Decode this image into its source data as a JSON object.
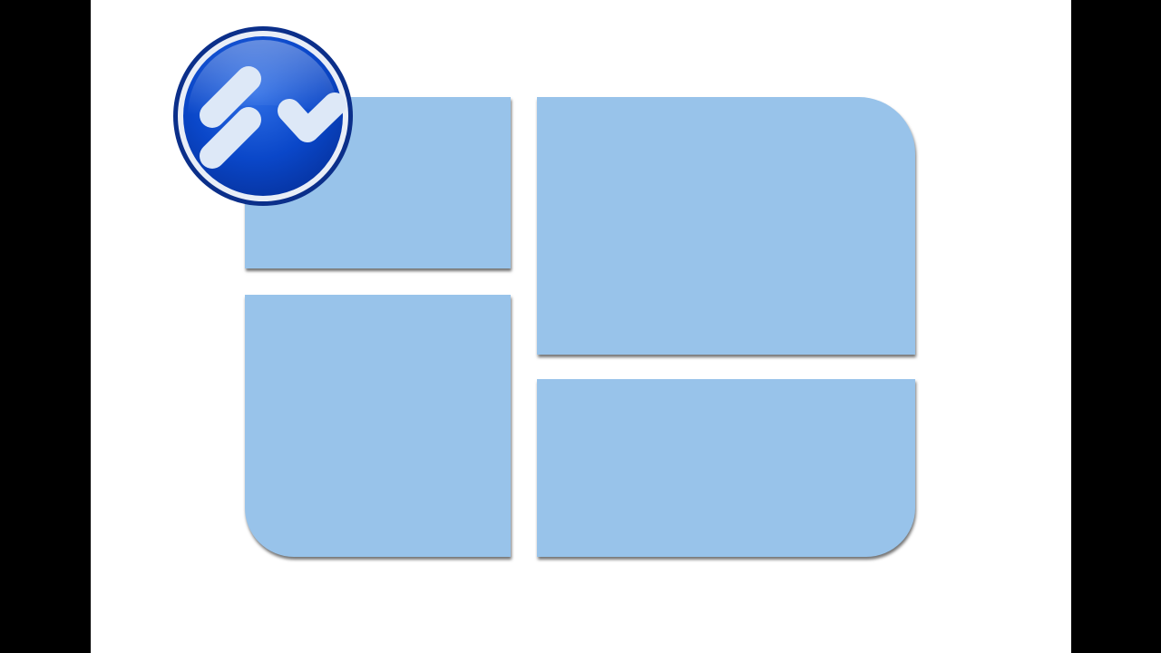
{
  "colors": {
    "background": "#ffffff",
    "letterbox": "#000000",
    "pane_fill": "#98c3ea",
    "badge_blue": "#0a47c9",
    "badge_glyph": "#dde8f7"
  },
  "graphic": {
    "description_icon": "windows-logo-icon",
    "badge_icon": "site-logo-badge-icon"
  }
}
